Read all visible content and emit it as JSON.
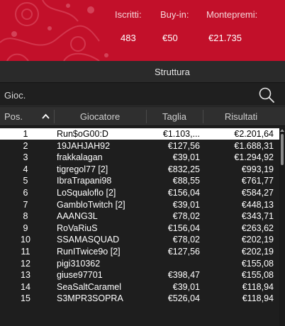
{
  "colors": {
    "banner_red": "#c2102a",
    "dark_bg": "#1e1e1e",
    "selected_row": "#ffffff"
  },
  "stats": {
    "labels": {
      "registered": "Iscritti:",
      "buyin": "Buy-in:",
      "prize_pool": "Montepremi:"
    },
    "values": {
      "registered": "483",
      "buyin": "€50",
      "prize_pool": "€21.735"
    }
  },
  "section": {
    "title": "Struttura"
  },
  "search": {
    "placeholder": "Gioc.",
    "icon": "search-icon"
  },
  "table": {
    "headers": {
      "pos": "Pos.",
      "player": "Giocatore",
      "size": "Taglia",
      "results": "Risultati"
    },
    "sort_icon": "chevron-up-icon",
    "selected_index": 0,
    "rows": [
      {
        "pos": "1",
        "player": "Run$oG00:D",
        "size": "€1.103,...",
        "results": "€2.201,64"
      },
      {
        "pos": "2",
        "player": "19JAHJAH92",
        "size": "€127,56",
        "results": "€1.688,31"
      },
      {
        "pos": "3",
        "player": "frakkalagan",
        "size": "€39,01",
        "results": "€1.294,92"
      },
      {
        "pos": "4",
        "player": "tigregol77 [2]",
        "size": "€832,25",
        "results": "€993,19"
      },
      {
        "pos": "5",
        "player": "IbraTrapani98",
        "size": "€88,55",
        "results": "€761,77"
      },
      {
        "pos": "6",
        "player": "LoSqualoflo [2]",
        "size": "€156,04",
        "results": "€584,27"
      },
      {
        "pos": "7",
        "player": "GambloTwitch [2]",
        "size": "€39,01",
        "results": "€448,13"
      },
      {
        "pos": "8",
        "player": "AAANG3L",
        "size": "€78,02",
        "results": "€343,71"
      },
      {
        "pos": "9",
        "player": "RoVaRiuS",
        "size": "€156,04",
        "results": "€263,62"
      },
      {
        "pos": "10",
        "player": "SSAMASQUAD",
        "size": "€78,02",
        "results": "€202,19"
      },
      {
        "pos": "11",
        "player": "RunITwice9o [2]",
        "size": "€127,56",
        "results": "€202,19"
      },
      {
        "pos": "12",
        "player": "pigi310362",
        "size": "",
        "results": "€155,08"
      },
      {
        "pos": "13",
        "player": "giuse97701",
        "size": "€398,47",
        "results": "€155,08"
      },
      {
        "pos": "14",
        "player": "SeaSaltCaramel",
        "size": "€39,01",
        "results": "€118,94"
      },
      {
        "pos": "15",
        "player": "S3MPR3SOPRA",
        "size": "€526,04",
        "results": "€118,94"
      }
    ]
  }
}
